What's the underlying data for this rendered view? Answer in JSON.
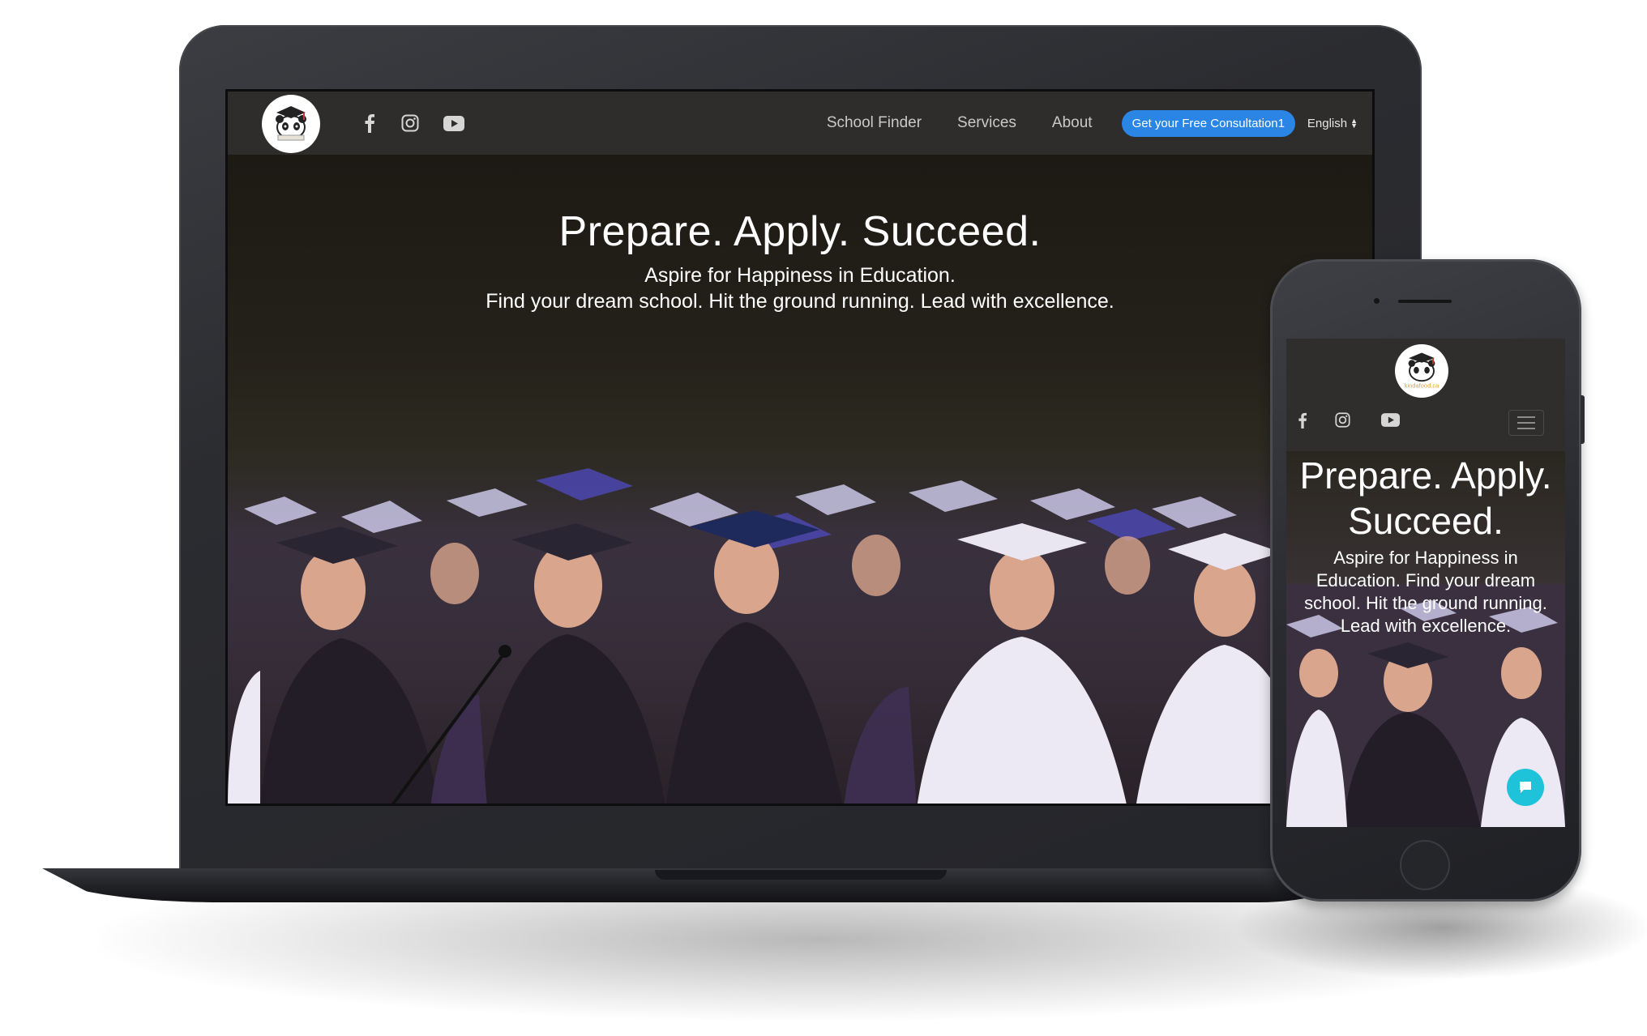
{
  "brand": {
    "logo_text": "kindafood.ca"
  },
  "nav": {
    "links": [
      "School Finder",
      "Services",
      "About"
    ],
    "cta_label": "Get your Free Consultation1",
    "language": "English"
  },
  "social_icons": [
    "facebook-icon",
    "instagram-icon",
    "youtube-icon"
  ],
  "hero": {
    "title": "Prepare. Apply. Succeed.",
    "subtitle_line1": "Aspire for Happiness in Education.",
    "subtitle_line2": "Find your dream school. Hit the ground running. Lead with excellence."
  },
  "mobile": {
    "title": "Prepare. Apply. Succeed.",
    "subtitle": "Aspire for Happiness in Education. Find your dream school. Hit the ground running. Lead with excellence.",
    "menu_icon": "hamburger-icon",
    "chat_icon": "chat-icon"
  },
  "colors": {
    "cta": "#2b85e4",
    "navbar": "#2e2d2b",
    "chat_button": "#1ec3d9",
    "device_frame": "#2b2c30"
  }
}
